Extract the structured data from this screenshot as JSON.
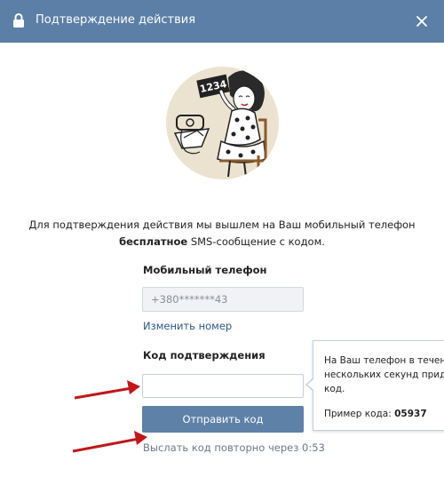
{
  "header": {
    "title": "Подтверждение действия",
    "background": "#5b7fa6",
    "lock_icon": "lock-icon",
    "close_icon": "close-icon"
  },
  "illustration": {
    "sign_text": "1234"
  },
  "info": {
    "line1": "Для подтверждения действия мы вышлем на Ваш мобильный телефон",
    "line2_bold": "бесплатное",
    "line2_rest": " SMS-сообщение с кодом."
  },
  "form": {
    "phone_label": "Мобильный телефон",
    "phone_value": "+380*******43",
    "change_link": "Изменить номер",
    "code_label": "Код подтверждения",
    "code_value": "",
    "submit_label": "Отправить код",
    "resend_text": "Выслать код повторно через 0:53"
  },
  "tooltip": {
    "text": "На Ваш телефон в течени\nнескольких секунд придё\nкод.",
    "example_label": "Пример кода: ",
    "example_code": "05937"
  },
  "colors": {
    "accent": "#5e81a8",
    "link": "#2a5885",
    "arrow": "#c0171b"
  }
}
